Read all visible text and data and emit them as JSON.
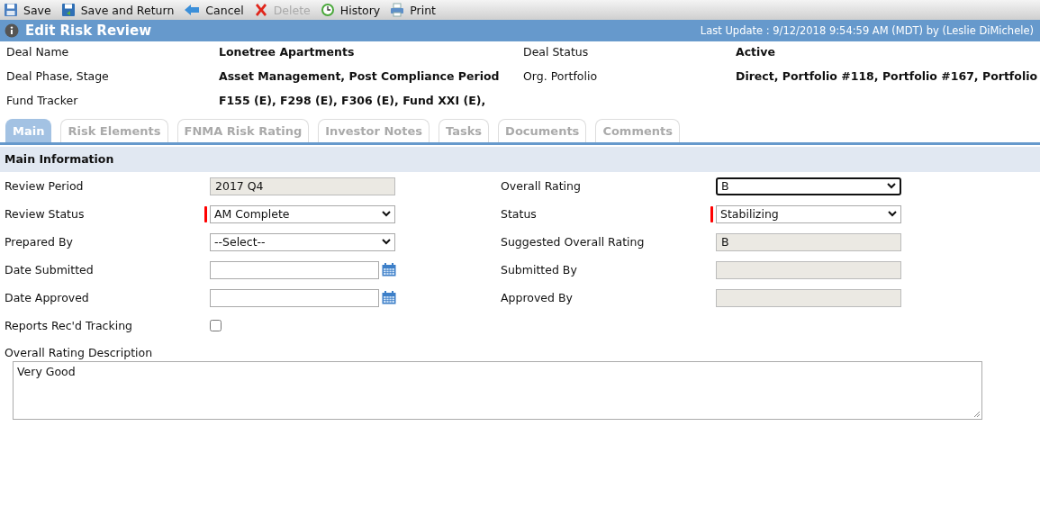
{
  "toolbar": [
    {
      "kind": "save",
      "label": "Save",
      "disabled": false
    },
    {
      "kind": "save-return",
      "label": "Save and Return",
      "disabled": false
    },
    {
      "kind": "cancel",
      "label": "Cancel",
      "disabled": false
    },
    {
      "kind": "delete",
      "label": "Delete",
      "disabled": true
    },
    {
      "kind": "history",
      "label": "History",
      "disabled": false
    },
    {
      "kind": "print",
      "label": "Print",
      "disabled": false
    }
  ],
  "title_bar": {
    "title": "Edit Risk Review",
    "last_update": "Last Update : 9/12/2018 9:54:59 AM (MDT) by (Leslie DiMichele)"
  },
  "deal_info": [
    {
      "label": "Deal Name",
      "value": "Lonetree Apartments"
    },
    {
      "label": "Deal Status",
      "value": "Active"
    },
    {
      "label": "Deal Phase, Stage",
      "value": "Asset Management, Post Compliance Period"
    },
    {
      "label": "Org. Portfolio",
      "value": "Direct, Portfolio #118, Portfolio #167, Portfolio"
    },
    {
      "label": "Fund Tracker",
      "value": "F155 (E), F298 (E), F306 (E), Fund XXI (E),"
    }
  ],
  "tabs": [
    {
      "label": "Main",
      "selected": true
    },
    {
      "label": "Risk Elements",
      "selected": false
    },
    {
      "label": "FNMA Risk Rating",
      "selected": false
    },
    {
      "label": "Investor Notes",
      "selected": false
    },
    {
      "label": "Tasks",
      "selected": false
    },
    {
      "label": "Documents",
      "selected": false
    },
    {
      "label": "Comments",
      "selected": false
    }
  ],
  "section_title": "Main Information",
  "fields": [
    {
      "label": "Review Period",
      "kind": "readonly",
      "value": "2017 Q4",
      "required": false
    },
    {
      "label": "Overall Rating",
      "kind": "select",
      "value": "B",
      "required": false,
      "focused": true
    },
    {
      "label": "Review Status",
      "kind": "select",
      "value": "AM Complete",
      "required": true,
      "focused": false
    },
    {
      "label": "Status",
      "kind": "select",
      "value": "Stabilizing",
      "required": true,
      "focused": false
    },
    {
      "label": "Prepared By",
      "kind": "select",
      "value": "--Select--",
      "required": false,
      "focused": false
    },
    {
      "label": "Suggested Overall Rating",
      "kind": "readonly",
      "value": "B",
      "required": false
    },
    {
      "label": "Date Submitted",
      "kind": "date",
      "required": false
    },
    {
      "label": "Submitted By",
      "kind": "readonly",
      "required": false
    },
    {
      "label": "Date Approved",
      "kind": "date",
      "required": false
    },
    {
      "label": "Approved By",
      "kind": "readonly",
      "required": false
    },
    {
      "label": "Reports Rec'd Tracking",
      "kind": "checkbox",
      "checked": false,
      "required": false
    }
  ],
  "description": {
    "label": "Overall Rating Description",
    "value": "Very Good"
  }
}
